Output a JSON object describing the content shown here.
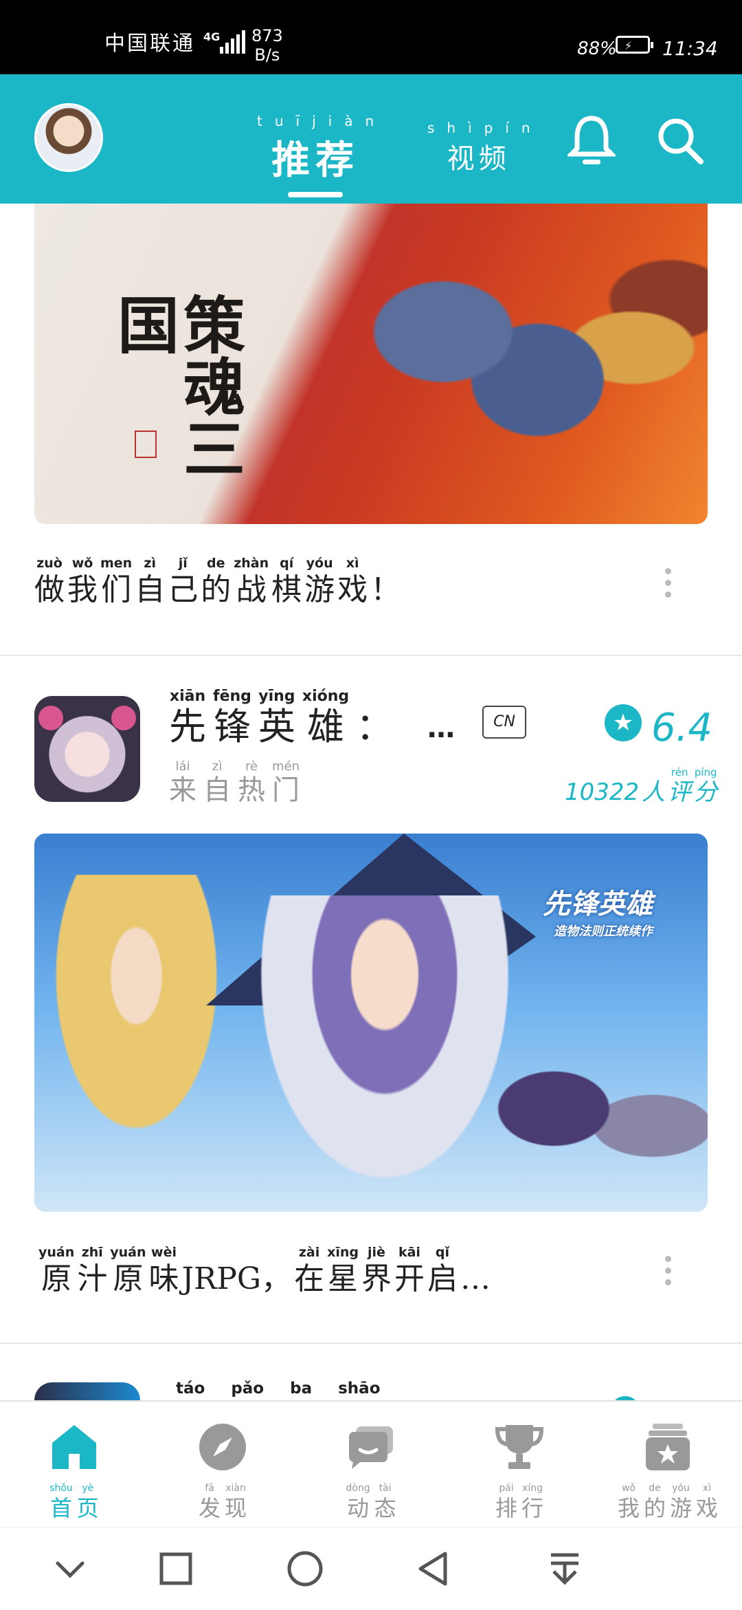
{
  "status_bar": {
    "carrier": "中国联通",
    "network": "4G",
    "speed_value": "873",
    "speed_unit": "B/s",
    "battery": "88%",
    "time": "11:34"
  },
  "header": {
    "tabs": [
      {
        "label": "推荐",
        "pinyin": [
          "tuī",
          "jiàn"
        ],
        "active": true
      },
      {
        "label": "视频",
        "pinyin": [
          "shì",
          "pín"
        ],
        "active": false
      }
    ]
  },
  "feed": [
    {
      "caption": [
        {
          "p": "zuò",
          "h": "做"
        },
        {
          "p": "wǒ",
          "h": "我"
        },
        {
          "p": "men",
          "h": "们"
        },
        {
          "p": "zì",
          "h": "自"
        },
        {
          "p": "jǐ",
          "h": "己"
        },
        {
          "p": "de",
          "h": "的"
        },
        {
          "p": "zhàn",
          "h": "战"
        },
        {
          "p": "qí",
          "h": "棋"
        },
        {
          "p": "yóu",
          "h": "游"
        },
        {
          "p": "xì",
          "h": "戏"
        },
        {
          "p": "",
          "h": "！"
        }
      ],
      "banner_text": "策魂三国"
    },
    {
      "game": {
        "title": [
          {
            "p": "xiān",
            "h": "先"
          },
          {
            "p": "fēng",
            "h": "锋"
          },
          {
            "p": "yīng",
            "h": "英"
          },
          {
            "p": "xióng",
            "h": "雄"
          },
          {
            "p": "",
            "h": "："
          }
        ],
        "ellipsis": "…",
        "region": "CN",
        "source": [
          {
            "p": "lái",
            "h": "来"
          },
          {
            "p": "zì",
            "h": "自"
          },
          {
            "p": "rè",
            "h": "热"
          },
          {
            "p": "mén",
            "h": "门"
          }
        ],
        "score": "6.4",
        "rating_count": "10322",
        "rating_suffix": [
          {
            "p": "",
            "h": "人"
          },
          {
            "p": "rén",
            "h": "评"
          },
          {
            "p": "píng",
            "h": "分"
          }
        ],
        "rating_suffix_pinyin": [
          "rén",
          "píng",
          "fēn"
        ]
      },
      "banner_logo": "先锋英雄",
      "banner_logo_sub": "造物法则正统续作",
      "caption": [
        {
          "p": "yuán",
          "h": "原"
        },
        {
          "p": "zhī",
          "h": "汁"
        },
        {
          "p": "yuán",
          "h": "原"
        },
        {
          "p": "wèi",
          "h": "味"
        },
        {
          "p": "",
          "h": "JRPG，"
        },
        {
          "p": "zài",
          "h": "在"
        },
        {
          "p": "xīng",
          "h": "星"
        },
        {
          "p": "jiè",
          "h": "界"
        },
        {
          "p": "kāi",
          "h": "开"
        },
        {
          "p": "qǐ",
          "h": "启"
        },
        {
          "p": "",
          "h": "…"
        }
      ]
    },
    {
      "title_pinyin_peek": "táo pǎo ba shāo"
    }
  ],
  "bottom_nav": [
    {
      "label": [
        {
          "p": "shǒu",
          "h": "首"
        },
        {
          "p": "yè",
          "h": "页"
        }
      ],
      "icon": "home-icon",
      "active": true
    },
    {
      "label": [
        {
          "p": "fā",
          "h": "发"
        },
        {
          "p": "xiàn",
          "h": "现"
        }
      ],
      "icon": "compass-icon",
      "active": false
    },
    {
      "label": [
        {
          "p": "dòng",
          "h": "动"
        },
        {
          "p": "tài",
          "h": "态"
        }
      ],
      "icon": "chat-icon",
      "active": false
    },
    {
      "label": [
        {
          "p": "pái",
          "h": "排"
        },
        {
          "p": "xíng",
          "h": "行"
        }
      ],
      "icon": "trophy-icon",
      "active": false
    },
    {
      "label": [
        {
          "p": "wǒ",
          "h": "我"
        },
        {
          "p": "de",
          "h": "的"
        },
        {
          "p": "yóu",
          "h": "游"
        },
        {
          "p": "xì",
          "h": "戏"
        }
      ],
      "icon": "game-box-icon",
      "active": false
    }
  ],
  "colors": {
    "accent": "#1bb7c7",
    "inactive": "#999999"
  }
}
